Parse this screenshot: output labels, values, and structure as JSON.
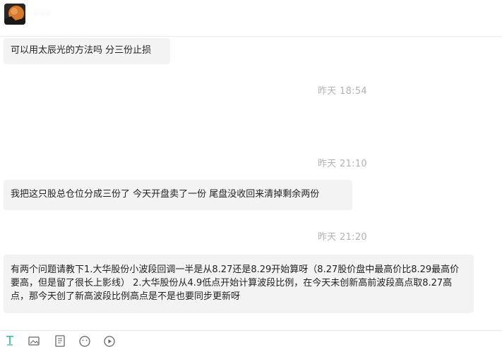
{
  "header": {
    "contact_name": "·  ·  ·",
    "avatar_icon": "user-avatar"
  },
  "messages": [
    {
      "text": "可以用太辰光的方法吗 分三份止损"
    },
    {
      "timestamp": "昨天 18:54"
    },
    {
      "timestamp": "昨天 21:10"
    },
    {
      "text": "我把这只股总仓位分成三份了 今天开盘卖了一份 尾盘没收回来清掉剩余两份"
    },
    {
      "timestamp": "昨天 21:20"
    },
    {
      "text": "有两个问题请教下1.大华股份小波段回调一半是从8.27还是8.29开始算呀（8.27股价盘中最高价比8.29最高价要高，但是留了很长上影线） 2.大华股份从4.9低点开始计算波段比例，在今天未创新高前波段高点取8.27高点，那今天创了新高波段比例高点是不是也要同步更新呀"
    }
  ],
  "toolbar": {
    "icons": [
      "text-format-icon",
      "image-icon",
      "document-icon",
      "emoji-icon",
      "play-icon"
    ],
    "accent_color": "#2eb398"
  }
}
